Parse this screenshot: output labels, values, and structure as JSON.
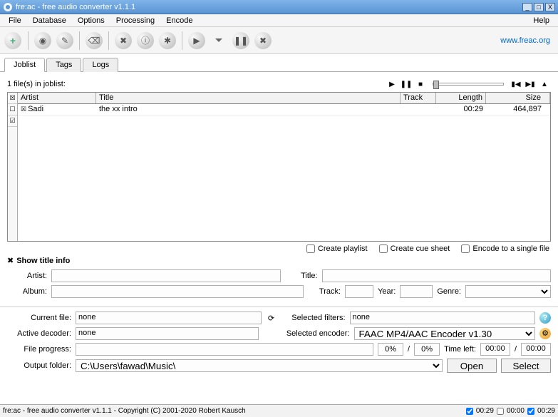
{
  "window": {
    "title": "fre:ac - free audio converter v1.1.1"
  },
  "menu": {
    "file": "File",
    "database": "Database",
    "options": "Options",
    "processing": "Processing",
    "encode": "Encode",
    "help": "Help"
  },
  "link": {
    "site": "www.freac.org"
  },
  "tabs": {
    "joblist": "Joblist",
    "tags": "Tags",
    "logs": "Logs"
  },
  "joblist": {
    "count_label": "1 file(s) in joblist:",
    "columns": {
      "artist": "Artist",
      "title": "Title",
      "track": "Track",
      "length": "Length",
      "size": "Size"
    },
    "rows": [
      {
        "artist": "Sadi",
        "title": "the xx intro",
        "track": "",
        "length": "00:29",
        "size": "464,897"
      }
    ]
  },
  "checks": {
    "playlist": "Create playlist",
    "cue": "Create cue sheet",
    "single": "Encode to a single file"
  },
  "titleinfo": {
    "label": "Show title info",
    "artist": "Artist:",
    "title": "Title:",
    "album": "Album:",
    "track": "Track:",
    "year": "Year:",
    "genre": "Genre:"
  },
  "bottom": {
    "current_file": "Current file:",
    "current_file_val": "none",
    "selected_filters": "Selected filters:",
    "selected_filters_val": "none",
    "active_decoder": "Active decoder:",
    "active_decoder_val": "none",
    "selected_encoder": "Selected encoder:",
    "selected_encoder_val": "FAAC MP4/AAC Encoder v1.30",
    "file_progress": "File progress:",
    "pct1": "0%",
    "slash": "/",
    "pct2": "0%",
    "time_left": "Time left:",
    "tl1": "00:00",
    "tl2": "00:00",
    "output_folder": "Output folder:",
    "output_folder_val": "C:\\Users\\fawad\\Music\\",
    "open": "Open",
    "select": "Select"
  },
  "status": {
    "text": "fre:ac - free audio converter v1.1.1 - Copyright (C) 2001-2020 Robert Kausch",
    "t1": "00:29",
    "t2": "00:00",
    "t3": "00:29"
  }
}
